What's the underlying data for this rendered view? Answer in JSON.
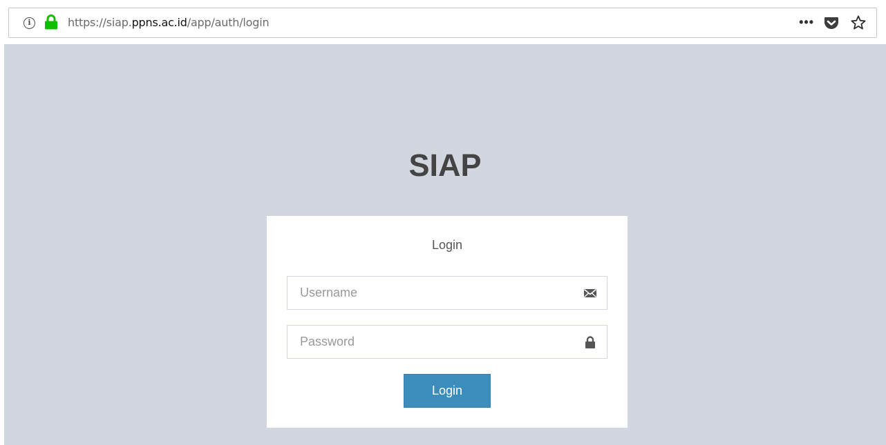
{
  "browser": {
    "url_prefix": "https://siap.",
    "url_domain": "ppns.ac.id",
    "url_suffix": "/app/auth/login",
    "icons": [
      "info-icon",
      "lock-icon",
      "more-icon",
      "pocket-icon",
      "star-icon"
    ],
    "lock_color": "#12bc00"
  },
  "page": {
    "background": "#d2d6de",
    "title": "SIAP",
    "login_box": {
      "message": "Login",
      "username_placeholder": "Username",
      "password_placeholder": "Password",
      "username_icon": "envelope-icon",
      "password_icon": "lock-icon",
      "submit_label": "Login",
      "button_color": "#3c8dbc"
    }
  }
}
